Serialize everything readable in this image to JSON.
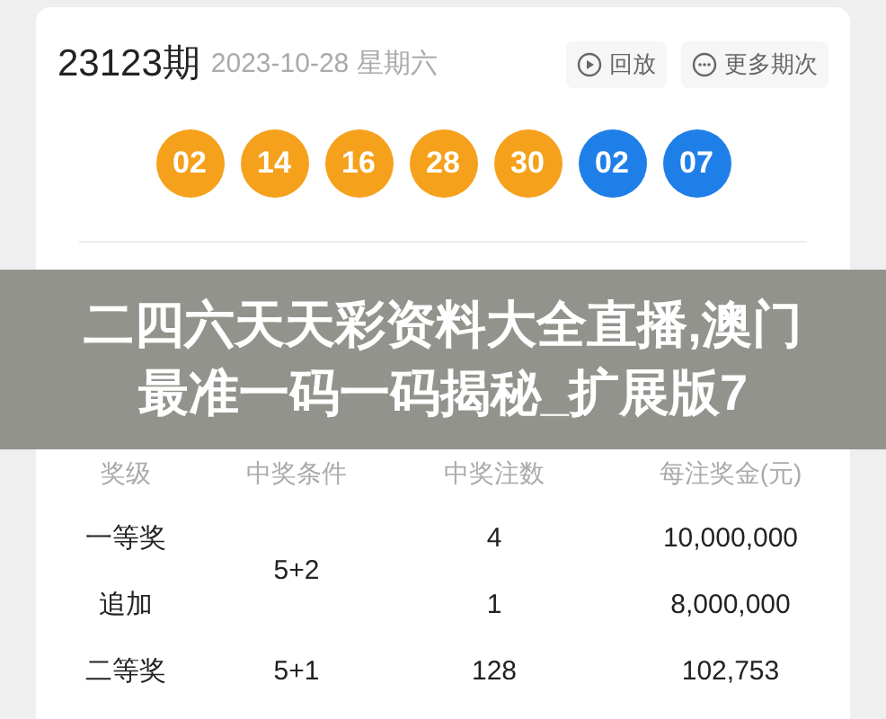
{
  "draw": {
    "issue": "23123期",
    "date": "2023-10-28 星期六",
    "actions": [
      {
        "kind": "replay",
        "label": "回放"
      },
      {
        "kind": "more",
        "label": "更多期次"
      }
    ]
  },
  "balls": [
    {
      "number": "02",
      "color": "#f5a11c"
    },
    {
      "number": "14",
      "color": "#f5a11c"
    },
    {
      "number": "16",
      "color": "#f5a11c"
    },
    {
      "number": "28",
      "color": "#f5a11c"
    },
    {
      "number": "30",
      "color": "#f5a11c"
    },
    {
      "number": "02",
      "color": "#1f7fe8"
    },
    {
      "number": "07",
      "color": "#1f7fe8"
    }
  ],
  "banner": {
    "title": "二四六天天彩资料大全直播,澳门最准一码一码揭秘_扩展版7"
  },
  "table": {
    "columns": [
      "奖级",
      "中奖条件",
      "中奖注数",
      "每注奖金(元)"
    ],
    "rows": [
      {
        "level": "一等奖",
        "condition": "5+2",
        "count": "4",
        "prize": "10,000,000"
      },
      {
        "level": "追加",
        "count": "1",
        "prize": "8,000,000"
      },
      {
        "level": "二等奖",
        "condition": "5+1",
        "count": "128",
        "prize": "102,753"
      }
    ]
  }
}
